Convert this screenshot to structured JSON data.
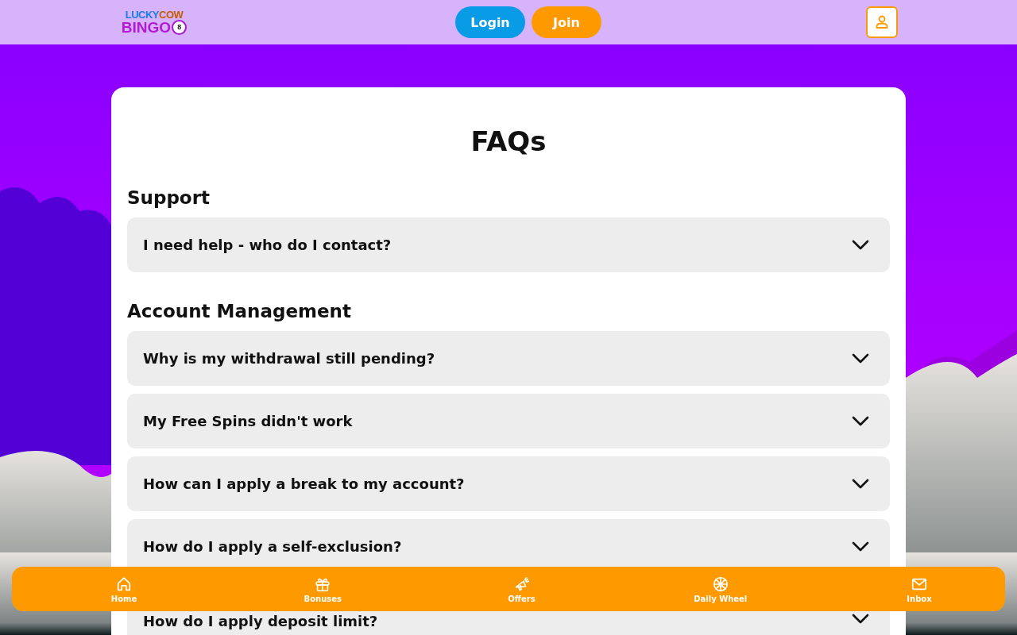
{
  "header": {
    "logo": {
      "line_1": "LUCKY",
      "line_2": "COW",
      "line_3": "BINGO",
      "ball": "8"
    },
    "buttons": [
      {
        "label": "Login",
        "kind": "login"
      },
      {
        "label": "Join",
        "kind": "join"
      }
    ]
  },
  "page": {
    "title": "FAQs",
    "sections": [
      {
        "heading": "Support",
        "questions": [
          {
            "text": "I need help - who do I contact?",
            "expanded": false
          }
        ]
      },
      {
        "heading": "Account Management",
        "questions": [
          {
            "text": "Why is my withdrawal still pending?",
            "expanded": false
          },
          {
            "text": "My Free Spins didn't work",
            "expanded": false
          },
          {
            "text": "How can I apply a break to my account?",
            "expanded": false
          },
          {
            "text": "How do I apply a self-exclusion?",
            "expanded": false
          },
          {
            "text": "How do I apply deposit limit?",
            "expanded": false
          }
        ]
      }
    ]
  },
  "bottom_nav": [
    {
      "label": "Home"
    },
    {
      "label": "Bonuses"
    },
    {
      "label": "Offers"
    },
    {
      "label": "Daily Wheel"
    },
    {
      "label": "Inbox"
    }
  ]
}
